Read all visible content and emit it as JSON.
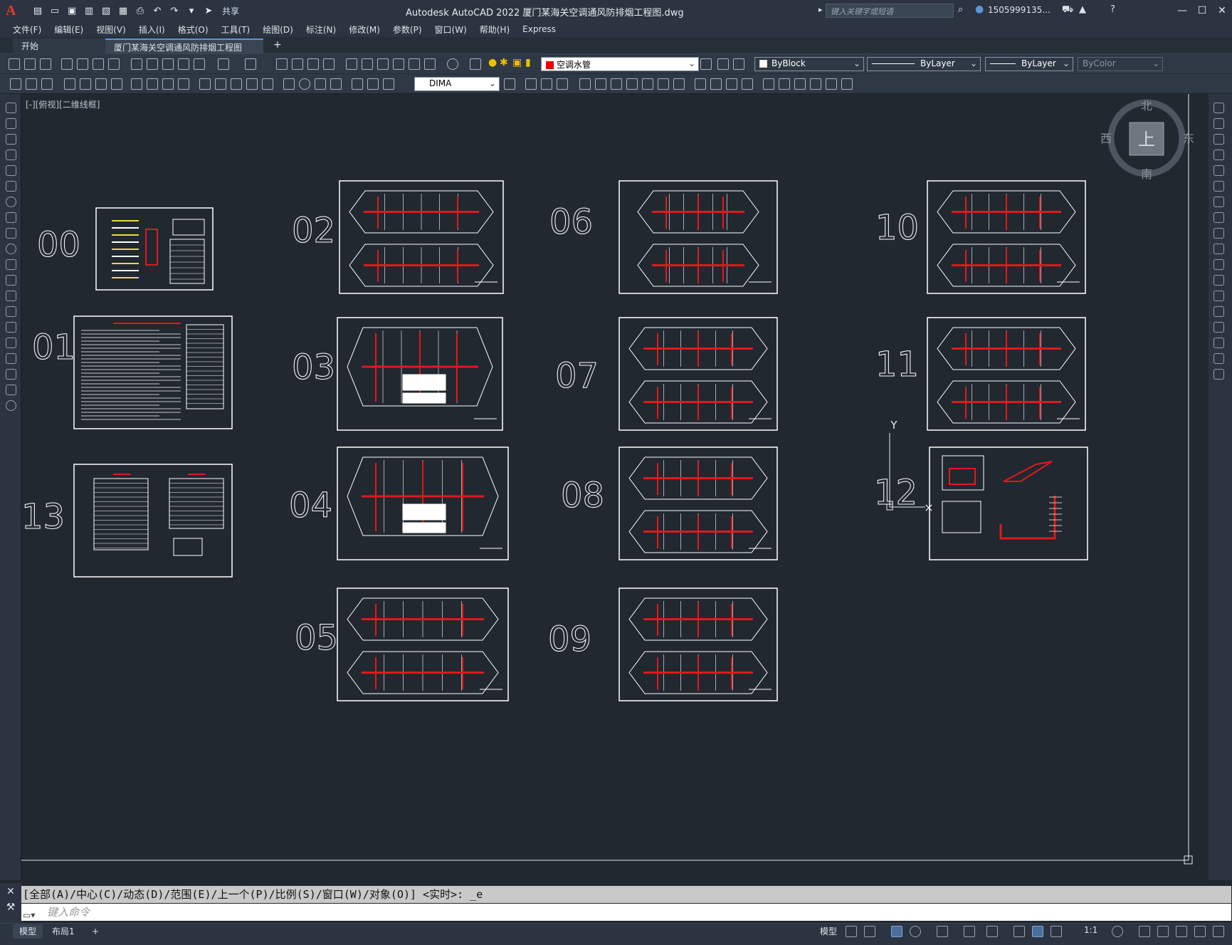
{
  "app": {
    "icon_letter": "A",
    "title": "Autodesk AutoCAD 2022    厦门某海关空调通风防排烟工程图.dwg",
    "share_label": "共享",
    "search_placeholder": "键入关键字或短语",
    "user_name": "1505999135...",
    "window_controls": [
      "—",
      "☐",
      "✕"
    ]
  },
  "menu": [
    "文件(F)",
    "编辑(E)",
    "视图(V)",
    "插入(I)",
    "格式(O)",
    "工具(T)",
    "绘图(D)",
    "标注(N)",
    "修改(M)",
    "参数(P)",
    "窗口(W)",
    "帮助(H)",
    "Express"
  ],
  "tabs": {
    "start": "开始",
    "active": "厦门某海关空调通风防排烟工程图*",
    "close": "✕",
    "add": "+"
  },
  "toolbar": {
    "layer_name": "空调水管",
    "color": "ByBlock",
    "linetype": "ByLayer",
    "lineweight": "ByLayer",
    "plotstyle": "ByColor",
    "dimstyle": "DIMA"
  },
  "viewport": {
    "label": "[-][俯视][二维线框]"
  },
  "viewcube": {
    "north": "北",
    "south": "南",
    "east": "东",
    "west": "西",
    "face": "上"
  },
  "ucs": {
    "y_label": "Y"
  },
  "sheets": [
    {
      "number": "00"
    },
    {
      "number": "01"
    },
    {
      "number": "13"
    },
    {
      "number": "02"
    },
    {
      "number": "03"
    },
    {
      "number": "04"
    },
    {
      "number": "05"
    },
    {
      "number": "06"
    },
    {
      "number": "07"
    },
    {
      "number": "08"
    },
    {
      "number": "09"
    },
    {
      "number": "10"
    },
    {
      "number": "11"
    },
    {
      "number": "12"
    }
  ],
  "command": {
    "history": "[全部(A)/中心(C)/动态(D)/范围(E)/上一个(P)/比例(S)/窗口(W)/对象(O)] <实时>: _e",
    "placeholder": "键入命令"
  },
  "status": {
    "tab_model": "模型",
    "tab_layout": "布局1",
    "tab_add": "+",
    "model_label": "模型",
    "scale": "1:1"
  },
  "colors": {
    "background": "#212830",
    "accent_red": "#e0191c",
    "frame_white": "#ffffff",
    "toolbar": "#2f3945"
  }
}
